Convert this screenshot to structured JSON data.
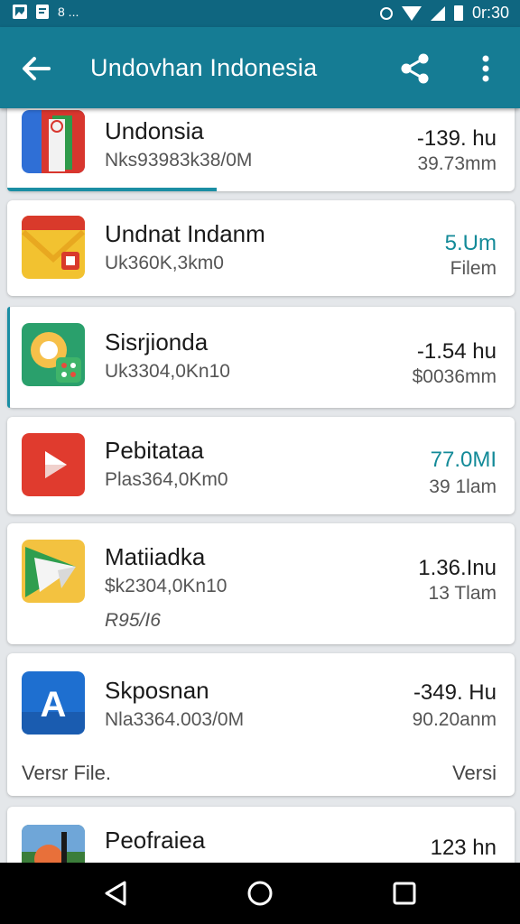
{
  "status_bar": {
    "time": "0r:30",
    "left_icons": [
      "image-icon",
      "note-icon",
      "dots-icon"
    ],
    "left_dots": "8 ..."
  },
  "app_bar": {
    "title": "Undovhan Indonesia",
    "back_icon": "arrow-back-icon",
    "share_icon": "share-icon",
    "more_icon": "more-vert-icon"
  },
  "items": [
    {
      "name": "Undonsia",
      "subtitle": "Nks93983k38/0M",
      "value": "-139. hu",
      "secondary": "39.73mm",
      "icon": "flag-app-icon",
      "progress": 0.4
    },
    {
      "name": "Undnat Indanm",
      "subtitle": "Uk360K,3km0",
      "value": "5.Um",
      "secondary": "Filem",
      "icon": "mail-app-icon",
      "value_color": "#138a98"
    },
    {
      "name": "Sisrjionda",
      "subtitle": "Uk3304,0Kn10",
      "value": "-1.54 hu",
      "secondary": "$0036mm",
      "icon": "map-app-icon"
    },
    {
      "name": "Pebitataa",
      "subtitle": "Plas364,0Km0",
      "value": "77.0MI",
      "secondary": "39 1lam",
      "icon": "play-app-icon",
      "value_color": "#138a98"
    },
    {
      "name": "Matiiadka",
      "subtitle": "$k2304,0Kn10",
      "extra": "R95/I6",
      "value": "1.36.Inu",
      "secondary": "13 Tlam",
      "icon": "play-store-icon"
    },
    {
      "name": "Skposnan",
      "subtitle": "Nla3364.003/0M",
      "value": "-349. Hu",
      "secondary": "90.20anm",
      "footer_left": "Versr File.",
      "footer_right": "Versi",
      "icon": "letter-a-icon"
    },
    {
      "name": "Peofraiea",
      "subtitle": "",
      "value": "123 hn",
      "secondary": "",
      "icon": "photo-app-icon"
    }
  ],
  "nav_bar": {
    "back_icon": "nav-back-icon",
    "home_icon": "nav-home-icon",
    "recents_icon": "nav-recents-icon"
  }
}
